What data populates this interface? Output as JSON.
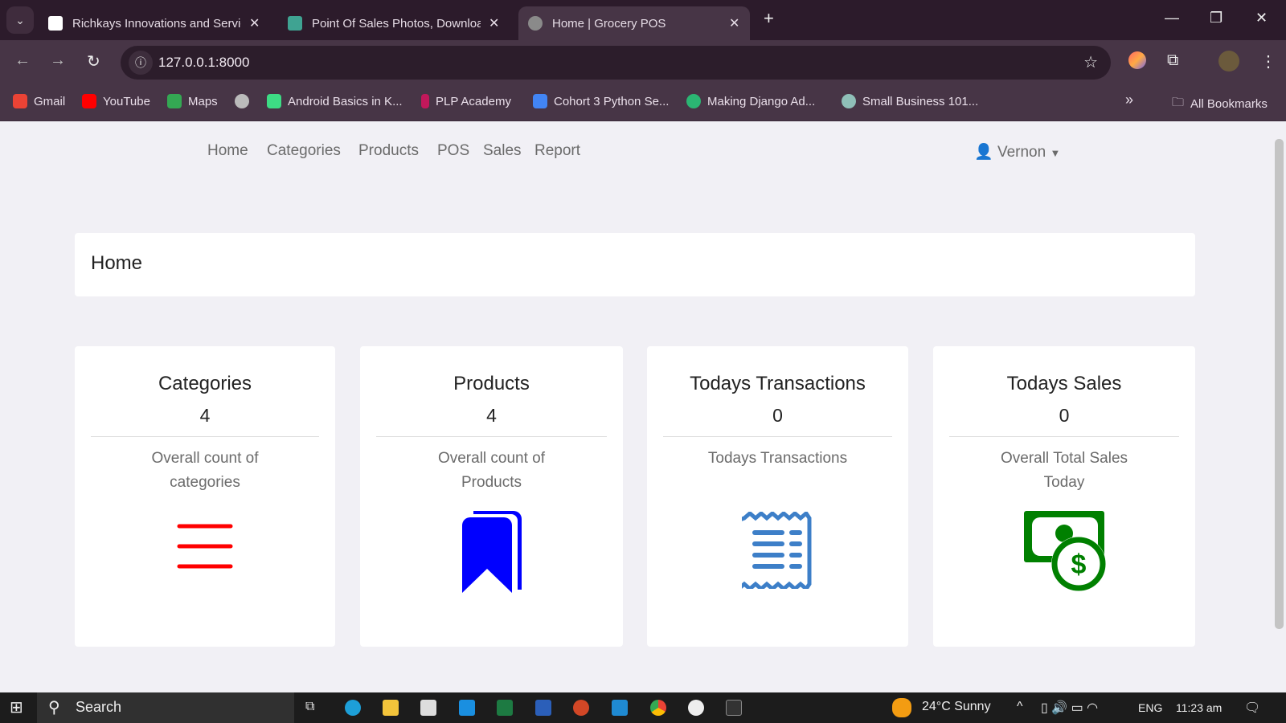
{
  "browser": {
    "tabs": [
      {
        "title": "Richkays Innovations and Servic",
        "active": false
      },
      {
        "title": "Point Of Sales Photos, Downloa",
        "active": false
      },
      {
        "title": "Home | Grocery POS",
        "active": true
      }
    ],
    "new_tab": "+",
    "url": "127.0.0.1:8000",
    "bookmarks": [
      {
        "label": "Gmail",
        "color": "#ea4335"
      },
      {
        "label": "YouTube",
        "color": "#ff0000"
      },
      {
        "label": "Maps",
        "color": "#34a853"
      },
      {
        "label": "",
        "color": "#bbbbbb"
      },
      {
        "label": "Android Basics in K...",
        "color": "#3ddc84"
      },
      {
        "label": "PLP Academy",
        "color": "#c2185b"
      },
      {
        "label": "Cohort 3 Python Se...",
        "color": "#4285f4"
      },
      {
        "label": "Making Django Ad...",
        "color": "#2bb673"
      },
      {
        "label": "Small Business 101...",
        "color": "#8fbfb8"
      }
    ],
    "more_bookmarks": "»",
    "all_bookmarks": "All Bookmarks"
  },
  "nav": {
    "items": [
      "Home",
      "Categories",
      "Products",
      "POS",
      "Sales",
      "Report"
    ],
    "user": "Vernon"
  },
  "header": {
    "title": "Home"
  },
  "cards": [
    {
      "title": "Categories",
      "value": "4",
      "desc": "Overall count of categories",
      "icon": "bars-icon",
      "color": "#ff0000"
    },
    {
      "title": "Products",
      "value": "4",
      "desc": "Overall count of Products",
      "icon": "bookmark-icon",
      "color": "#0000ff"
    },
    {
      "title": "Todays Transactions",
      "value": "0",
      "desc": "Todays Transactions",
      "icon": "receipt-icon",
      "color": "#3d7fc8"
    },
    {
      "title": "Todays Sales",
      "value": "0",
      "desc": "Overall Total Sales Today",
      "icon": "money-icon",
      "color": "#008000"
    }
  ],
  "taskbar": {
    "search": "Search",
    "weather": "24°C  Sunny",
    "lang": "ENG",
    "time": "11:23 am"
  }
}
